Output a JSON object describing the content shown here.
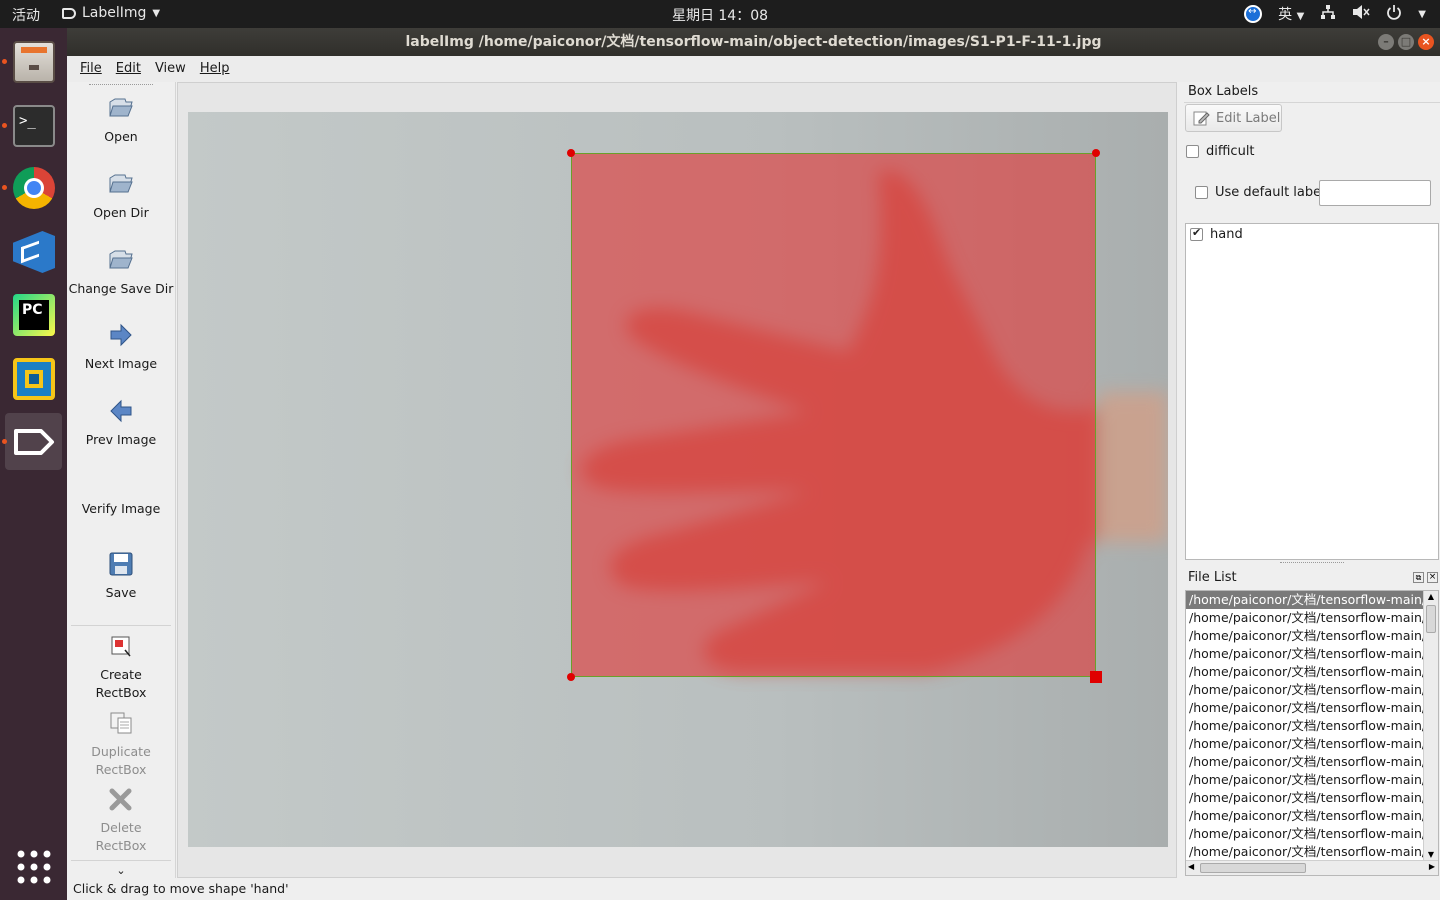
{
  "topbar": {
    "activities": "活动",
    "app_name": "LabelImg",
    "clock": "星期日 14：08",
    "input_method": "英"
  },
  "window": {
    "title": "labelImg /home/paiconor/文档/tensorflow-main/object-detection/images/S1-P1-F-11-1.jpg"
  },
  "menu": {
    "file": "File",
    "edit": "Edit",
    "view": "View",
    "help": "Help"
  },
  "toolbar": {
    "open": "Open",
    "open_dir": "Open Dir",
    "change_save_dir": "Change Save Dir",
    "next_image": "Next Image",
    "prev_image": "Prev Image",
    "verify_image": "Verify Image",
    "save": "Save",
    "create_rectbox_1": "Create",
    "create_rectbox_2": "RectBox",
    "duplicate_rectbox_1": "Duplicate",
    "duplicate_rectbox_2": "RectBox",
    "delete_rectbox_1": "Delete",
    "delete_rectbox_2": "RectBox"
  },
  "box_labels": {
    "title": "Box Labels",
    "edit_label": "Edit Label",
    "difficult": "difficult",
    "use_default_label": "Use default label",
    "default_label_value": "",
    "labels": [
      {
        "name": "hand",
        "checked": true
      }
    ]
  },
  "file_list": {
    "title": "File List",
    "items": [
      "/home/paiconor/文档/tensorflow-main/ob",
      "/home/paiconor/文档/tensorflow-main/ob",
      "/home/paiconor/文档/tensorflow-main/ob",
      "/home/paiconor/文档/tensorflow-main/ob",
      "/home/paiconor/文档/tensorflow-main/ob",
      "/home/paiconor/文档/tensorflow-main/ob",
      "/home/paiconor/文档/tensorflow-main/ob",
      "/home/paiconor/文档/tensorflow-main/ob",
      "/home/paiconor/文档/tensorflow-main/ob",
      "/home/paiconor/文档/tensorflow-main/ob",
      "/home/paiconor/文档/tensorflow-main/ob",
      "/home/paiconor/文档/tensorflow-main/ob",
      "/home/paiconor/文档/tensorflow-main/ob",
      "/home/paiconor/文档/tensorflow-main/ob",
      "/home/paiconor/文档/tensorflow-main/ob"
    ]
  },
  "status": "Click & drag to move shape 'hand'",
  "colors": {
    "box_fill": "#e13737",
    "box_border": "#6aa02a",
    "handle": "#e00000",
    "dock_bg": "#3a2833",
    "accent": "#e95420"
  }
}
